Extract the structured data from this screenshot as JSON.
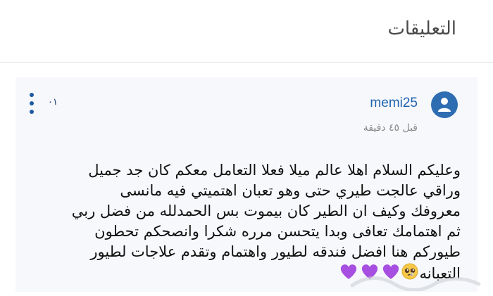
{
  "header": {
    "title": "التعليقات"
  },
  "comment": {
    "username": "memi25",
    "time": "قبل ٤٥ دقيقة",
    "number": "٠١",
    "lines": [
      "وعليكم السلام اهلا عالم ميلا فعلا التعامل معكم كان جد جميل",
      "وراقي عالجت طيري حتى وهو تعبان اهتميتي فيه مانسى",
      "معروفك وكيف ان الطير كان بيموت بس الحمدلله من فضل ربي",
      "ثم اهتمامك تعافى وبدا يتحسن  مرره شكرا وانصحكم تحطون",
      "طيوركم هنا افضل فندقه لطيور واهتمام وتقدم علاجات لطيور",
      "التعبانه"
    ]
  },
  "icons": {
    "avatar": "user-icon",
    "more": "vertical-dots-icon",
    "emoji": [
      "pleading-face-emoji",
      "purple-heart-emoji",
      "purple-heart-emoji",
      "purple-heart-emoji"
    ]
  },
  "colors": {
    "accent": "#1e63b0",
    "avatar_bg": "#2f6db3",
    "card_bg": "#f6f8fb",
    "heart": "#a64fe0"
  }
}
